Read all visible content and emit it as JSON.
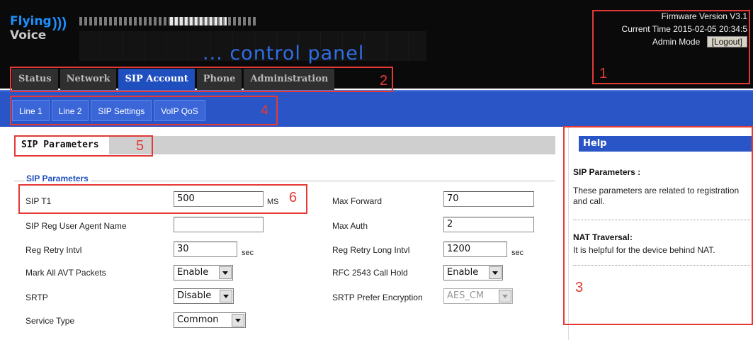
{
  "brand": {
    "logo_line1": "Flying",
    "logo_line2": "Voice",
    "tagline": "... control panel"
  },
  "info": {
    "firmware_version": "Firmware Version V3.1",
    "current_time": "Current Time 2015-02-05 20:34:5",
    "mode": "Admin Mode",
    "logout_label": "[Logout]"
  },
  "main_tabs": [
    "Status",
    "Network",
    "SIP Account",
    "Phone",
    "Administration"
  ],
  "active_main_tab": "SIP Account",
  "sub_tabs": [
    "Line 1",
    "Line 2",
    "SIP Settings",
    "VoIP QoS"
  ],
  "active_sub_tab": "SIP Settings",
  "section_title": "SIP Parameters",
  "fieldset_legend": "SIP Parameters",
  "form": {
    "sip_t1": {
      "label": "SIP T1",
      "value": "500",
      "unit": "MS"
    },
    "reg_user_agent": {
      "label": "SIP Reg User Agent Name",
      "value": ""
    },
    "reg_retry": {
      "label": "Reg Retry Intvl",
      "value": "30",
      "unit": "sec"
    },
    "mark_avt": {
      "label": "Mark All AVT Packets",
      "value": "Enable"
    },
    "srtp": {
      "label": "SRTP",
      "value": "Disable"
    },
    "service_type": {
      "label": "Service Type",
      "value": "Common"
    },
    "max_forward": {
      "label": "Max Forward",
      "value": "70"
    },
    "max_auth": {
      "label": "Max Auth",
      "value": "2"
    },
    "reg_retry_long": {
      "label": "Reg Retry Long Intvl",
      "value": "1200",
      "unit": "sec"
    },
    "rfc2543": {
      "label": "RFC 2543 Call Hold",
      "value": "Enable"
    },
    "srtp_encryption": {
      "label": "SRTP Prefer Encryption",
      "value": "AES_CM"
    }
  },
  "help": {
    "title": "Help",
    "sip_heading": "SIP Parameters :",
    "sip_text": "These parameters are related to registration and call.",
    "nat_heading": "NAT Traversal:",
    "nat_text": "It is helpful for the device behind NAT."
  },
  "callouts": [
    "1",
    "2",
    "3",
    "4",
    "5",
    "6"
  ],
  "colors": {
    "accent_blue": "#2a55c6",
    "header_bg": "#0a0a0a",
    "callout_red": "#e53935"
  }
}
